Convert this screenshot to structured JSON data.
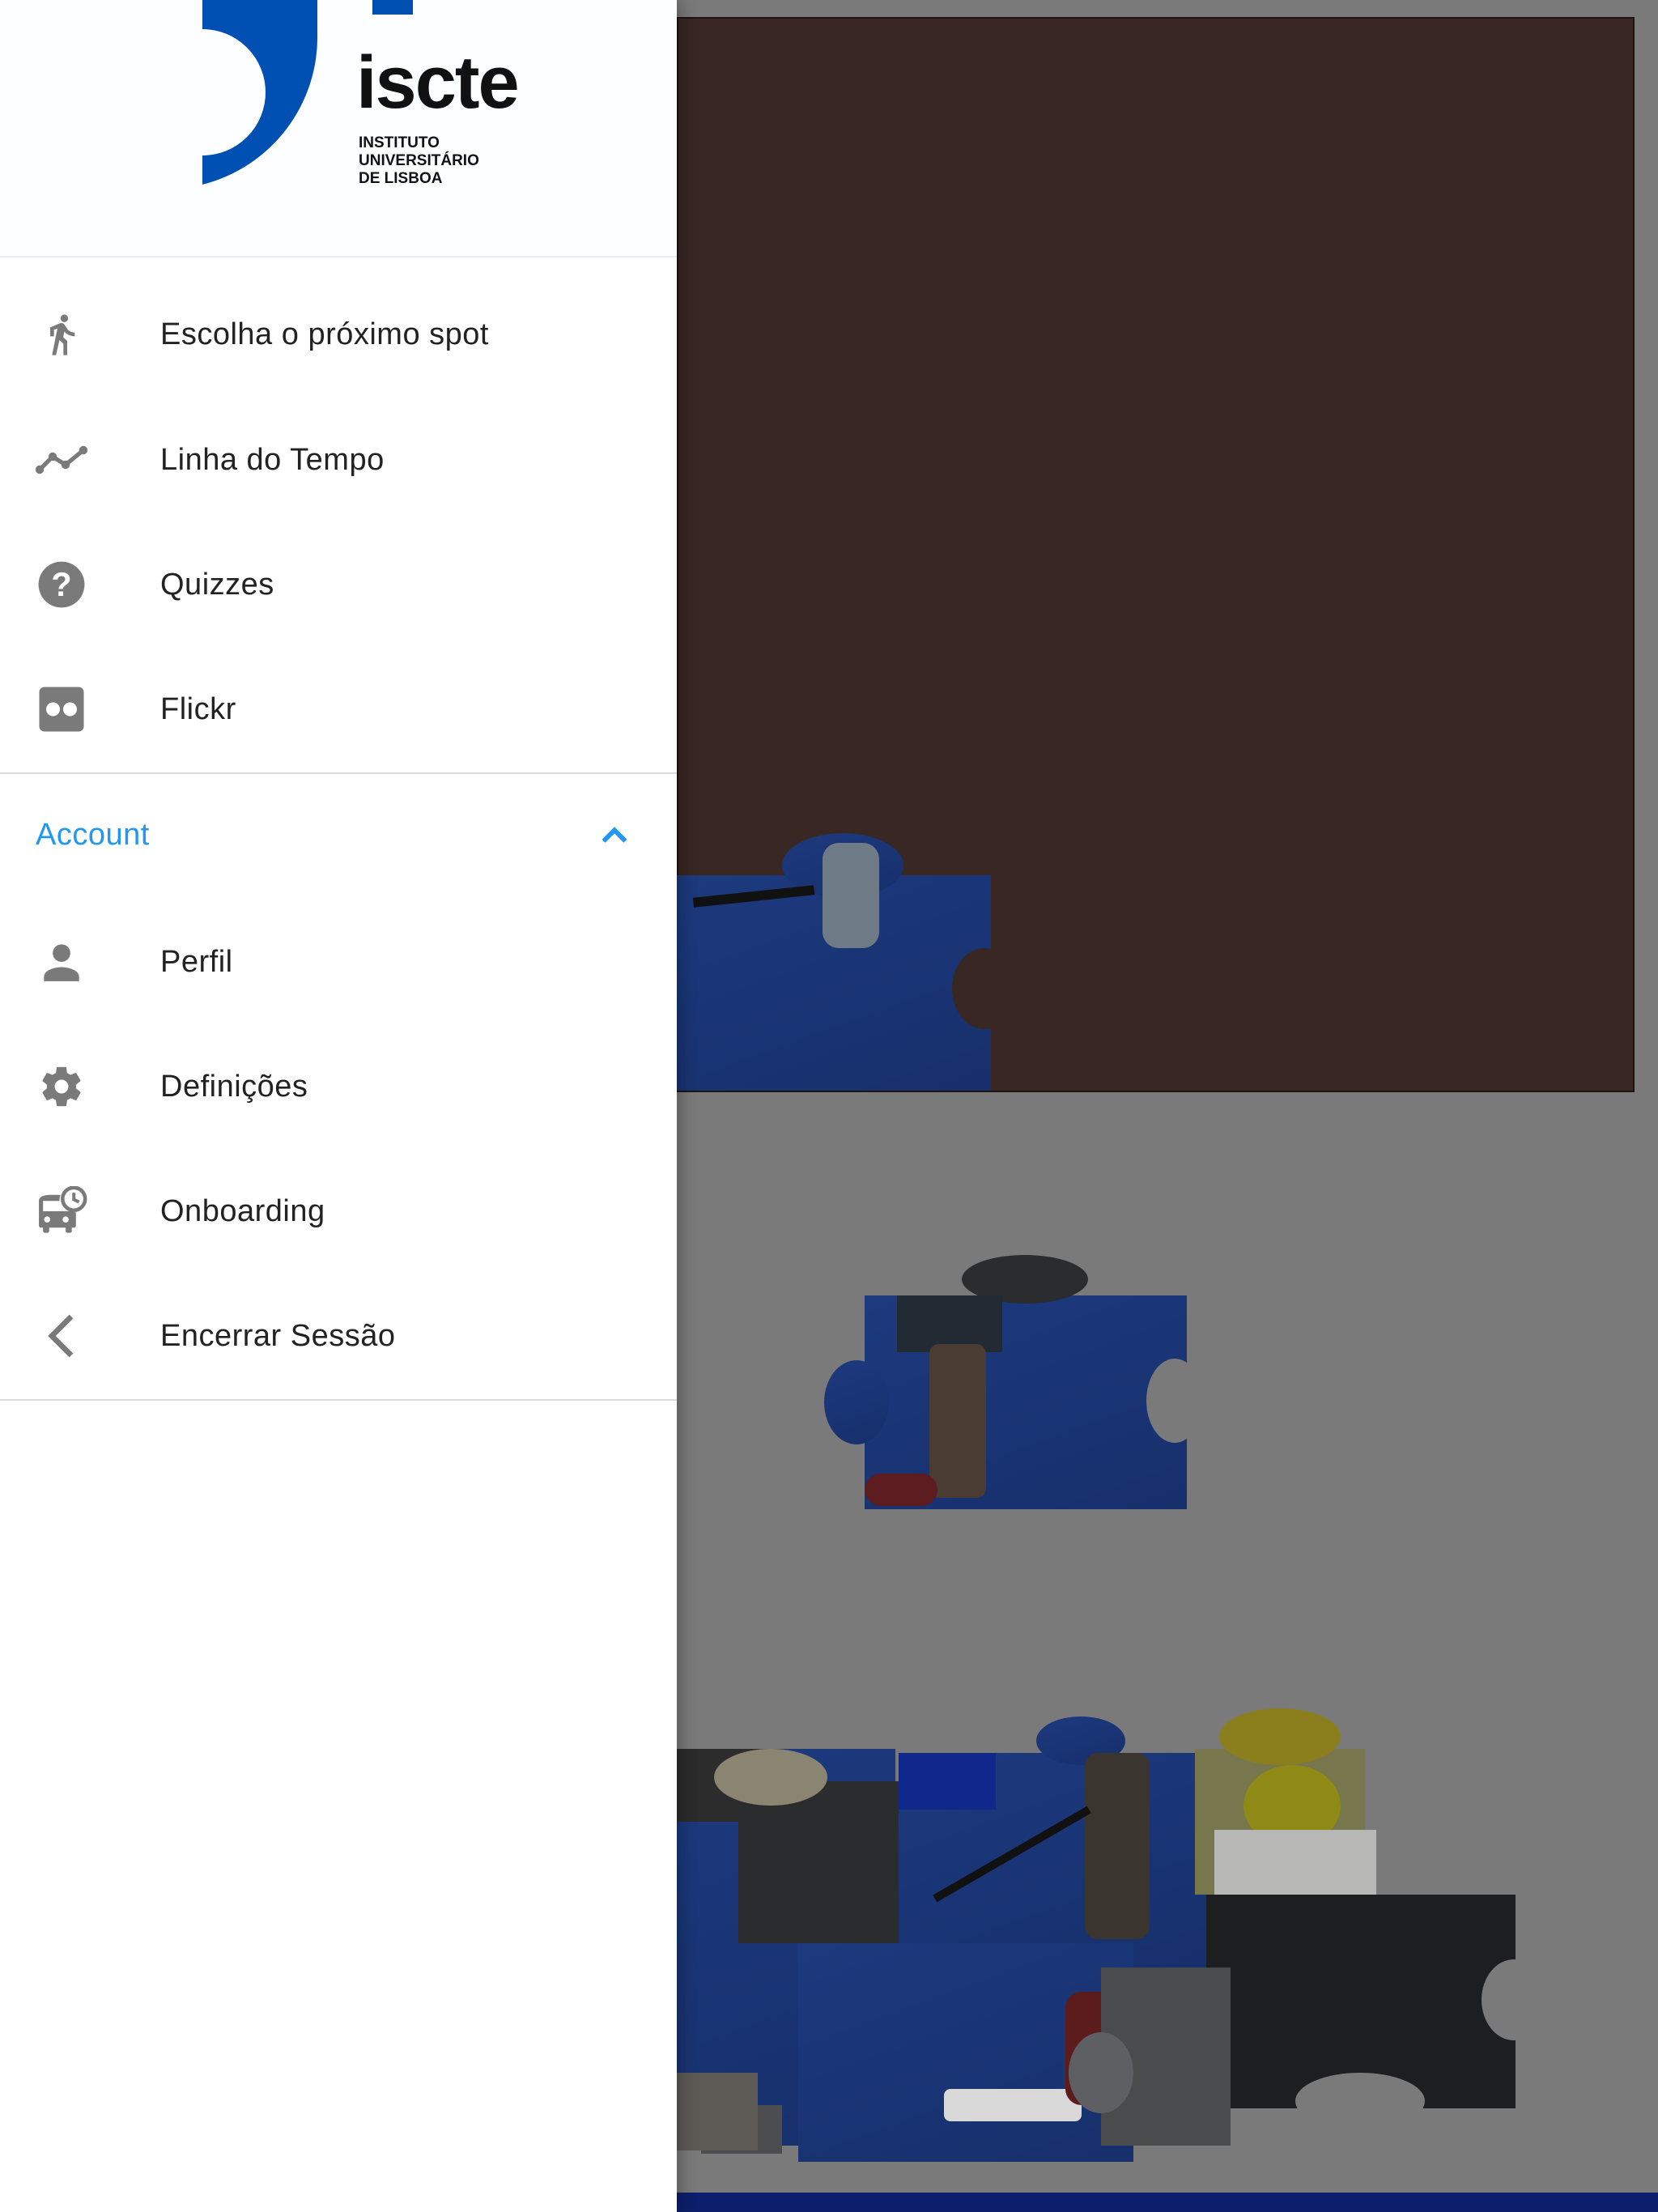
{
  "drawer": {
    "logo": {
      "wordmark": "iscte",
      "subtitle_lines": [
        "INSTITUTO",
        "UNIVERSITÁRIO",
        "DE LISBOA"
      ],
      "brand_color": "#0050b4"
    },
    "main_items": [
      {
        "label": "Escolha o próximo spot",
        "icon": "running-person-icon"
      },
      {
        "label": "Linha do Tempo",
        "icon": "timeline-icon"
      },
      {
        "label": "Quizzes",
        "icon": "help-circle-icon"
      },
      {
        "label": "Flickr",
        "icon": "flickr-icon"
      }
    ],
    "account_section": {
      "label": "Account",
      "expanded": true,
      "accent_color": "#2196f3",
      "items": [
        {
          "label": "Perfil",
          "icon": "person-icon"
        },
        {
          "label": "Definições",
          "icon": "gear-icon"
        },
        {
          "label": "Onboarding",
          "icon": "bus-clock-icon"
        },
        {
          "label": "Encerrar Sessão",
          "icon": "chevron-left-icon"
        }
      ]
    }
  },
  "background": {
    "puzzle_board_color": "#382723",
    "scrim": "dimmed"
  }
}
